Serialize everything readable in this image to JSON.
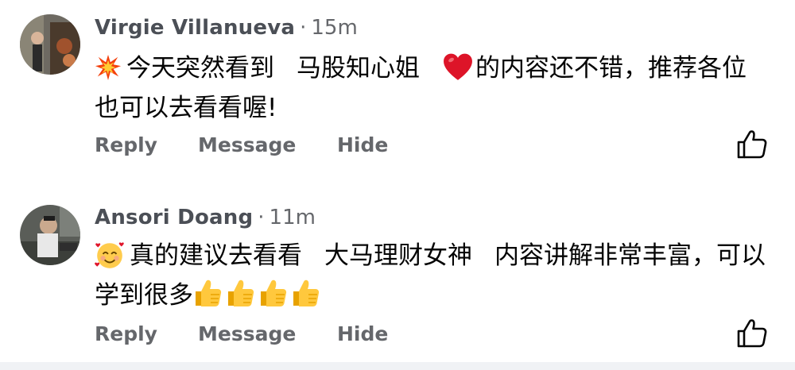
{
  "comments": [
    {
      "author": "Virgie Villanueva",
      "separator": "·",
      "time": "15m",
      "text_parts": [
        "今天突然看到",
        "马股知心姐",
        "的内容还不错，推荐各位也可以去看看喔!"
      ],
      "emojis": [
        "collision-emoji",
        "red-heart-emoji"
      ],
      "actions": {
        "reply": "Reply",
        "message": "Message",
        "hide": "Hide"
      }
    },
    {
      "author": "Ansori Doang",
      "separator": "·",
      "time": "11m",
      "text_parts": [
        "真的建议去看看",
        "大马理财女神",
        "内容讲解非常丰富，可以学到很多"
      ],
      "emojis": [
        "smiling-face-with-hearts-emoji",
        "thumbs-up-emoji",
        "thumbs-up-emoji",
        "thumbs-up-emoji",
        "thumbs-up-emoji"
      ],
      "actions": {
        "reply": "Reply",
        "message": "Message",
        "hide": "Hide"
      }
    }
  ],
  "icons": {
    "like": "thumbs-up-outline-icon"
  },
  "colors": {
    "name": "#4b4f56",
    "meta": "#65676b",
    "text": "#050505",
    "heart": "#e0162b",
    "thumb": "#fbc02d"
  }
}
